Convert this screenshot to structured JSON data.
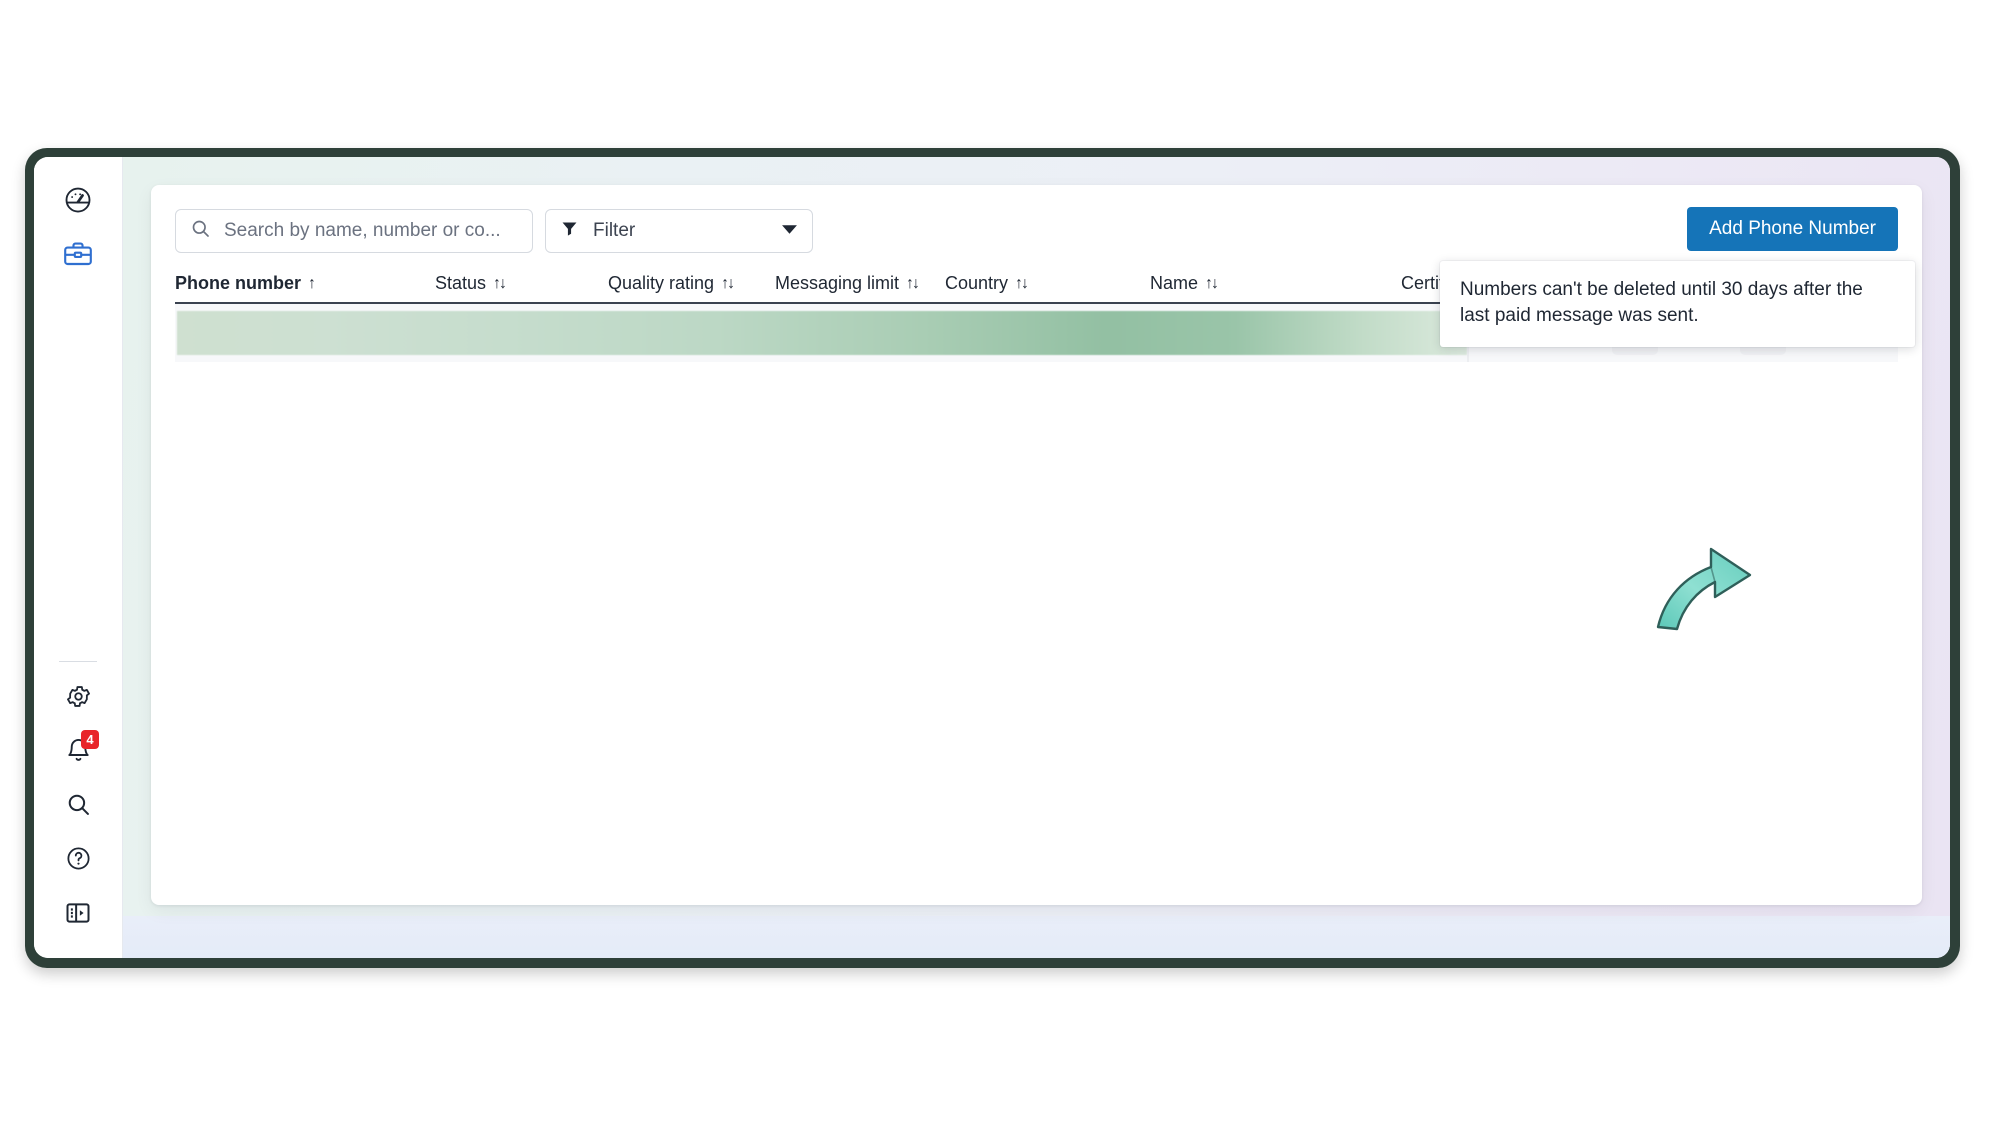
{
  "window": {
    "frame_color": "#2e4039",
    "background_gradient": [
      "#e7f2ee",
      "#eae4f3"
    ]
  },
  "sidebar": {
    "top_items": [
      {
        "name": "dashboard",
        "icon": "speedometer-icon",
        "active": false
      },
      {
        "name": "business",
        "icon": "briefcase-icon",
        "active": true,
        "color": "#2f6fd0"
      }
    ],
    "bottom_items": [
      {
        "name": "settings",
        "icon": "gear-icon",
        "badge": ""
      },
      {
        "name": "notifications",
        "icon": "bell-icon",
        "badge": "4"
      },
      {
        "name": "search",
        "icon": "magnifier-icon",
        "badge": ""
      },
      {
        "name": "help",
        "icon": "question-circle-icon",
        "badge": ""
      },
      {
        "name": "toggle-panel",
        "icon": "panel-toggle-icon",
        "badge": ""
      }
    ],
    "badge_color": "#e8252a"
  },
  "toolbar": {
    "search": {
      "placeholder": "Search by name, number or co...",
      "value": ""
    },
    "filter_label": "Filter",
    "add_phone_label": "Add Phone Number",
    "add_phone_color": "#1574b8"
  },
  "table": {
    "columns": [
      {
        "label": "Phone number",
        "sort": "asc",
        "sort_glyph": "↑",
        "active": true
      },
      {
        "label": "Status",
        "sort": "none",
        "sort_glyph": "↑↓",
        "active": false
      },
      {
        "label": "Quality rating",
        "sort": "none",
        "sort_glyph": "↑↓",
        "active": false
      },
      {
        "label": "Messaging limit",
        "sort": "none",
        "sort_glyph": "↑↓",
        "active": false
      },
      {
        "label": "Country",
        "sort": "none",
        "sort_glyph": "↑↓",
        "active": false
      },
      {
        "label": "Name",
        "sort": "none",
        "sort_glyph": "↑↓",
        "active": false
      },
      {
        "label": "Certifica",
        "sort": "none",
        "sort_glyph": "",
        "active": false
      }
    ],
    "rows": [
      {
        "redacted": true,
        "redaction_color": "#a9cdb4",
        "actions": [
          {
            "name": "delete-row-button",
            "icon": "trash-icon"
          },
          {
            "name": "row-settings-button",
            "icon": "gear-icon"
          }
        ]
      }
    ]
  },
  "tooltip": {
    "text": "Numbers can't be deleted until 30 days after the last paid message was sent."
  },
  "annotation": {
    "type": "curved-arrow",
    "color": "#6fd4c4",
    "points_to": "delete-row-button"
  }
}
